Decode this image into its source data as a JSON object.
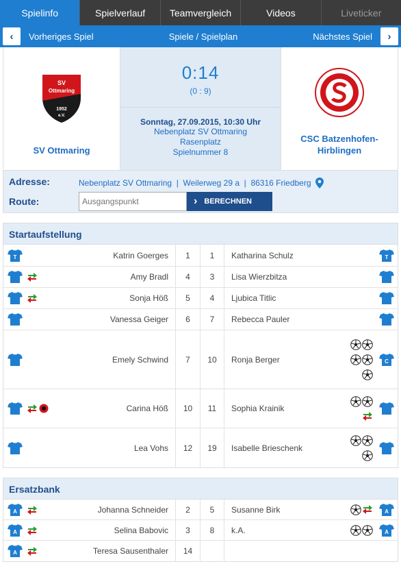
{
  "tabs": [
    {
      "label": "Spielinfo",
      "state": "active"
    },
    {
      "label": "Spielverlauf",
      "state": "normal"
    },
    {
      "label": "Teamvergleich",
      "state": "normal"
    },
    {
      "label": "Videos",
      "state": "normal"
    },
    {
      "label": "Liveticker",
      "state": "disabled"
    }
  ],
  "nav": {
    "prev": "Vorheriges Spiel",
    "center": "Spiele / Spielplan",
    "next": "Nächstes Spiel"
  },
  "match": {
    "home": "SV Ottmaring",
    "away_line1": "CSC Batzenhofen-",
    "away_line2": "Hirblingen",
    "score": "0:14",
    "halftime": "(0 : 9)",
    "date": "Sonntag, 27.09.2015, 10:30 Uhr",
    "venue": "Nebenplatz SV Ottmaring",
    "surface": "Rasenplatz",
    "matchno": "Spielnummer 8",
    "home_logo_text": [
      "SV",
      "Ottmaring",
      "1952",
      "e.V."
    ]
  },
  "address": {
    "label": "Adresse:",
    "value": "Nebenplatz SV Ottmaring  |  Weilerweg 29 a  |  86316 Friedberg",
    "route_label": "Route:",
    "placeholder": "Ausgangspunkt",
    "button": "BERECHNEN"
  },
  "colors": {
    "accent": "#1f7ed0",
    "dark": "#1f4e8c",
    "jersey": "#1f7ed0"
  },
  "lineup": {
    "title": "Startaufstellung",
    "rows": [
      {
        "home_jersey": "T",
        "home_ev": [],
        "home": "Katrin Goerges",
        "hn": "1",
        "an": "1",
        "away": "Katharina Schulz",
        "away_ev": [],
        "away_jersey": "T",
        "h": 32
      },
      {
        "home_jersey": "",
        "home_ev": [
          "sub"
        ],
        "home": "Amy Bradl",
        "hn": "4",
        "an": "3",
        "away": "Lisa Wierzbitza",
        "away_ev": [],
        "away_jersey": "",
        "h": 31
      },
      {
        "home_jersey": "",
        "home_ev": [
          "sub"
        ],
        "home": "Sonja Höß",
        "hn": "5",
        "an": "4",
        "away": "Ljubica Titlic",
        "away_ev": [],
        "away_jersey": "",
        "h": 31
      },
      {
        "home_jersey": "",
        "home_ev": [],
        "home": "Vanessa Geiger",
        "hn": "6",
        "an": "7",
        "away": "Rebecca Pauler",
        "away_ev": [],
        "away_jersey": "",
        "h": 31
      },
      {
        "home_jersey": "",
        "home_ev": [],
        "home": "Emely Schwind",
        "hn": "7",
        "an": "10",
        "away": "Ronja Berger",
        "away_ev": [
          [
            "ball",
            "ball"
          ],
          [
            "ball",
            "ball"
          ],
          [
            "ball"
          ]
        ],
        "away_jersey": "C",
        "h": 86
      },
      {
        "home_jersey": "",
        "home_ev": [
          "sub",
          "card"
        ],
        "home": "Carina Höß",
        "hn": "10",
        "an": "11",
        "away": "Sophia Krainik",
        "away_ev": [
          [
            "ball",
            "ball"
          ],
          [
            "sub"
          ]
        ],
        "away_jersey": "",
        "h": 57
      },
      {
        "home_jersey": "",
        "home_ev": [],
        "home": "Lea Vohs",
        "hn": "12",
        "an": "19",
        "away": "Isabelle Brieschenk",
        "away_ev": [
          [
            "ball",
            "ball"
          ],
          [
            "ball"
          ]
        ],
        "away_jersey": "",
        "h": 57
      }
    ]
  },
  "bench": {
    "title": "Ersatzbank",
    "rows": [
      {
        "home_jersey": "A",
        "home_ev": [
          "sub"
        ],
        "home": "Johanna Schneider",
        "hn": "2",
        "an": "5",
        "away": "Susanne Birk",
        "away_ev": [
          [
            "ball",
            "sub"
          ]
        ],
        "away_jersey": "A",
        "h": 30
      },
      {
        "home_jersey": "A",
        "home_ev": [
          "sub"
        ],
        "home": "Selina Babovic",
        "hn": "3",
        "an": "8",
        "away": "k.A.",
        "away_ev": [
          [
            "ball",
            "ball"
          ]
        ],
        "away_jersey": "A",
        "h": 30
      },
      {
        "home_jersey": "A",
        "home_ev": [
          "sub"
        ],
        "home": "Teresa Sausenthaler",
        "hn": "14",
        "an": "",
        "away": "",
        "away_ev": [],
        "away_jersey": "",
        "h": 30
      }
    ]
  }
}
